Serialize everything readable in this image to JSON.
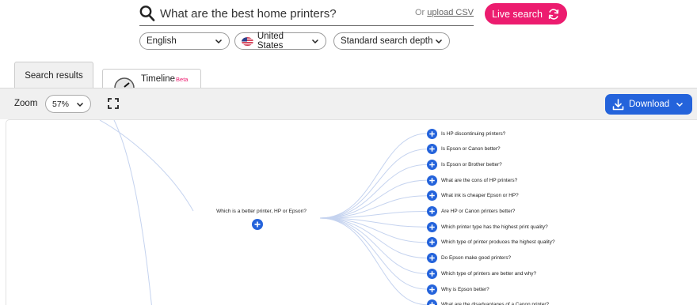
{
  "search": {
    "query": "What are the best home printers?",
    "or_text": "Or",
    "upload_label": "upload CSV",
    "live_label": "Live search"
  },
  "filters": {
    "language": "English",
    "country": "United States",
    "depth": "Standard search depth"
  },
  "tabs": {
    "results_label": "Search results",
    "timeline_label": "Timeline",
    "timeline_badge": "Beta"
  },
  "toolbar": {
    "zoom_label": "Zoom",
    "zoom_value": "57%",
    "download_label": "Download"
  },
  "tree": {
    "root_question": "Which is a better printer, HP or Epson?",
    "leaves": [
      "Is HP discontinuing printers?",
      "Is Epson or Canon better?",
      "Is Epson or Brother better?",
      "What are the cons of HP printers?",
      "What ink is cheaper Epson or HP?",
      "Are HP or Canon printers better?",
      "Which printer type has the highest print quality?",
      "Which type of printer produces the highest quality?",
      "Do Epson make good printers?",
      "Which type of printers are better and why?",
      "Why is Epson better?",
      "What are the disadvantages of a Canon printer?"
    ]
  },
  "colors": {
    "accent_pink": "#ec1c6f",
    "accent_blue": "#2463db",
    "link_line": "#c5d3ef"
  }
}
